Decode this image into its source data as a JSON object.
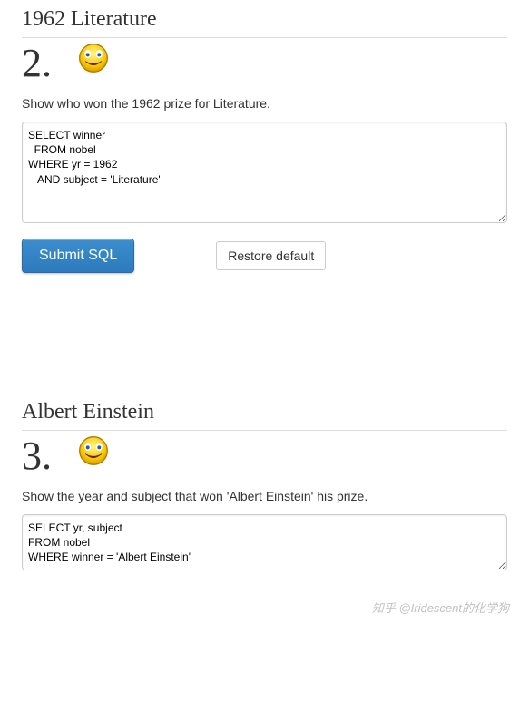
{
  "exercises": [
    {
      "title": "1962 Literature",
      "number": "2.",
      "description": "Show who won the 1962 prize for Literature.",
      "sql": "SELECT winner\n  FROM nobel\nWHERE yr = 1962\n   AND subject = 'Literature'",
      "submit_label": "Submit SQL",
      "restore_label": "Restore default"
    },
    {
      "title": "Albert Einstein",
      "number": "3.",
      "description": "Show the year and subject that won 'Albert Einstein' his prize.",
      "sql": "SELECT yr, subject\nFROM nobel\nWHERE winner = 'Albert Einstein'"
    }
  ],
  "watermark": "知乎 @Iridescent的化学狗"
}
